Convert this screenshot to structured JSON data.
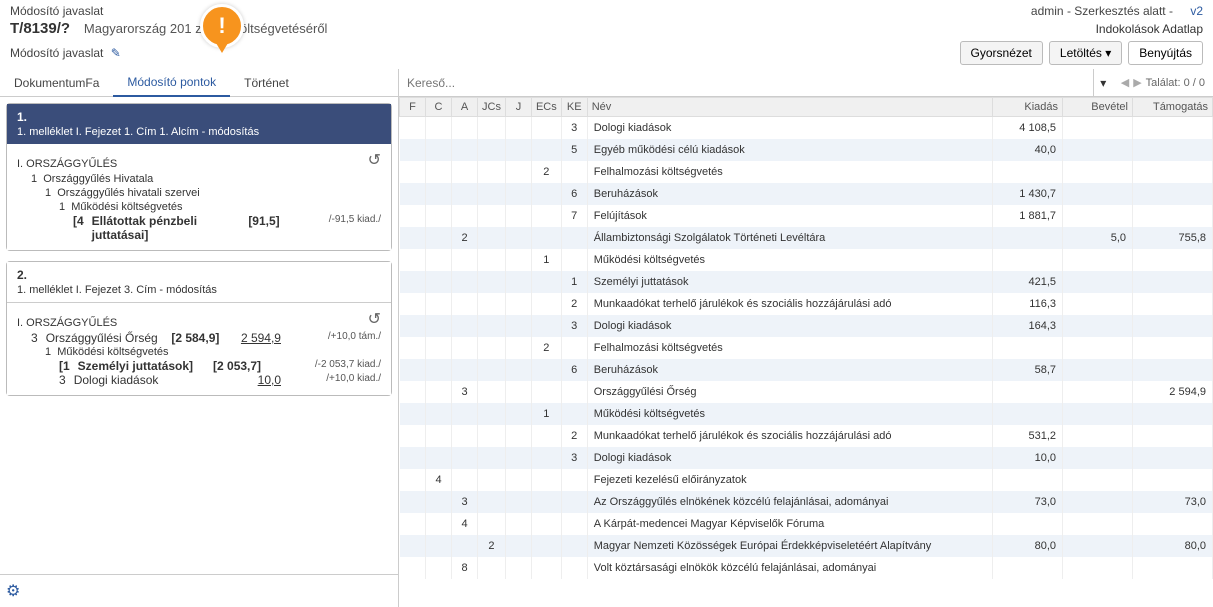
{
  "header": {
    "breadcrumb": "Módosító javaslat",
    "user_status": "admin - Szerkesztés alatt - ",
    "version": "v2",
    "link_indokolasok": "Indokolások",
    "link_adatlap": "Adatlap",
    "doc_id": "T/8139/?",
    "doc_title": "Magyarország 201       zponti költségvetéséről",
    "edit_label": "Módosító javaslat",
    "btn_quick": "Gyorsnézet",
    "btn_download": "Letöltés",
    "btn_submit": "Benyújtás"
  },
  "tabs": {
    "t1": "DokumentumFa",
    "t2": "Módosító pontok",
    "t3": "Történet"
  },
  "mod1": {
    "num": "1.",
    "title": "1. melléklet I. Fejezet 1. Cím 1. Alcím - módosítás",
    "heading": "I. ORSZÁGGYŰLÉS",
    "l1_num": "1",
    "l1_txt": "Országgyűlés Hivatala",
    "l2_num": "1",
    "l2_txt": "Országgyűlés hivatali szervei",
    "l3_num": "1",
    "l3_txt": "Működési költségvetés",
    "l4_num": "[4",
    "l4_txt": "Ellátottak pénzbeli juttatásai]",
    "l4_v1": "[91,5]",
    "l4_delta": "/-91,5 kiad./"
  },
  "mod2": {
    "num": "2.",
    "title": "1. melléklet I. Fejezet 3. Cím - módosítás",
    "heading": "I. ORSZÁGGYŰLÉS",
    "l1_num": "3",
    "l1_txt": "Országgyűlési Őrség",
    "l1_v1": "[2 584,9]",
    "l1_v2": "2 594,9",
    "l1_delta": "/+10,0 tám./",
    "l2_num": "1",
    "l2_txt": "Működési költségvetés",
    "l3_num": "[1",
    "l3_txt": "Személyi juttatások]",
    "l3_v1": "[2 053,7]",
    "l3_delta": "/-2 053,7 kiad./",
    "l4_num": "3",
    "l4_txt": "Dologi kiadások",
    "l4_v2": "10,0",
    "l4_delta": "/+10,0 kiad./"
  },
  "search": {
    "placeholder": "Kereső...",
    "result_label": "Találat: 0 / 0"
  },
  "columns": {
    "f": "F",
    "c": "C",
    "a": "A",
    "jcs": "JCs",
    "j": "J",
    "ecs": "ECs",
    "ke": "KE",
    "nev": "Név",
    "kiadas": "Kiadás",
    "bevetel": "Bevétel",
    "tamogatas": "Támogatás"
  },
  "rows": [
    {
      "ke": "3",
      "nev": "Dologi kiadások",
      "kiadas": "4 108,5"
    },
    {
      "ke": "5",
      "nev": "Egyéb működési célú kiadások",
      "kiadas": "40,0"
    },
    {
      "ecs": "2",
      "nev": "Felhalmozási költségvetés"
    },
    {
      "ke": "6",
      "nev": "Beruházások",
      "kiadas": "1 430,7"
    },
    {
      "ke": "7",
      "nev": "Felújítások",
      "kiadas": "1 881,7"
    },
    {
      "a": "2",
      "nev": "Állambiztonsági Szolgálatok Történeti Levéltára",
      "bevetel": "5,0",
      "tamogatas": "755,8"
    },
    {
      "ecs": "1",
      "nev": "Működési költségvetés"
    },
    {
      "ke": "1",
      "nev": "Személyi juttatások",
      "kiadas": "421,5"
    },
    {
      "ke": "2",
      "nev": "Munkaadókat terhelő járulékok és szociális hozzájárulási adó",
      "kiadas": "116,3"
    },
    {
      "ke": "3",
      "nev": "Dologi kiadások",
      "kiadas": "164,3"
    },
    {
      "ecs": "2",
      "nev": "Felhalmozási költségvetés"
    },
    {
      "ke": "6",
      "nev": "Beruházások",
      "kiadas": "58,7"
    },
    {
      "a": "3",
      "nev": "Országgyűlési Őrség",
      "tamogatas": "2 594,9"
    },
    {
      "ecs": "1",
      "nev": "Működési költségvetés"
    },
    {
      "ke": "2",
      "nev": "Munkaadókat terhelő járulékok és szociális hozzájárulási adó",
      "kiadas": "531,2"
    },
    {
      "ke": "3",
      "nev": "Dologi kiadások",
      "kiadas": "10,0"
    },
    {
      "c": "4",
      "nev": "Fejezeti kezelésű előirányzatok"
    },
    {
      "a": "3",
      "nev": "Az Országgyűlés elnökének közcélú felajánlásai, adományai",
      "kiadas": "73,0",
      "tamogatas": "73,0"
    },
    {
      "a": "4",
      "nev": "A Kárpát-medencei Magyar Képviselők Fóruma"
    },
    {
      "jcs": "2",
      "nev": "Magyar Nemzeti Közösségek Európai Érdekképviseletéért Alapítvány",
      "kiadas": "80,0",
      "tamogatas": "80,0"
    },
    {
      "a": "8",
      "nev": "Volt köztársasági elnökök közcélú felajánlásai, adományai"
    }
  ]
}
